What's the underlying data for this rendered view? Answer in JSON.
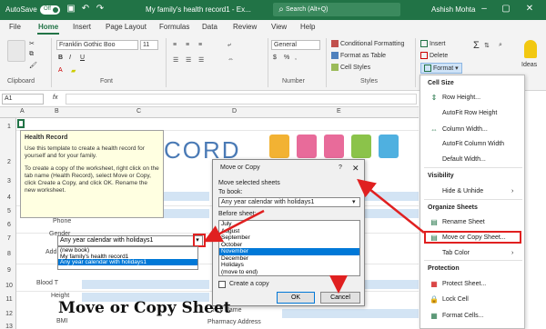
{
  "titlebar": {
    "autosave": "AutoSave",
    "toggle": "Off",
    "doc_title": "My family's health record1 - Ex...",
    "search_placeholder": "Search (Alt+Q)",
    "user": "Ashish Mohta"
  },
  "tabs": [
    "File",
    "Home",
    "Insert",
    "Page Layout",
    "Formulas",
    "Data",
    "Review",
    "View",
    "Help"
  ],
  "ribbon": {
    "clipboard_label": "Clipboard",
    "font_name": "Franklin Gothic Boo",
    "font_size": "11",
    "font_label": "Font",
    "number_format": "General",
    "number_label": "Number",
    "conditional_formatting": "Conditional Formatting",
    "format_as_table": "Format as Table",
    "cell_styles": "Cell Styles",
    "styles_label": "Styles",
    "insert": "Insert",
    "delete": "Delete",
    "format": "Format",
    "ideas": "Ideas"
  },
  "formula_bar": {
    "name_box": "A1",
    "fx": "fx"
  },
  "columns": [
    "A",
    "B",
    "C",
    "D",
    "E"
  ],
  "rows": [
    "1",
    "2",
    "3",
    "4",
    "5",
    "6",
    "7",
    "8",
    "9",
    "10",
    "11",
    "12",
    "13"
  ],
  "sheet": {
    "title_fragment": "CORD",
    "labels": [
      "Phone",
      "Gender",
      "Add",
      "Blood T",
      "Height",
      "BMI"
    ],
    "d_labels": [
      "ncy Name",
      "Pharmacy Address"
    ]
  },
  "tooltip": {
    "title": "Health Record",
    "body1": "Use this template to create a health record for yourself and for your family.",
    "body2": "To create a copy of the worksheet, right click on the tab name (Health Record), select Move or Copy, click Create a Copy, and click OK. Rename the new worksheet."
  },
  "combo": {
    "value": "Any year calendar with holidays1",
    "options": [
      "(new book)",
      "My family's health record1",
      "Any year calendar with holidays1"
    ],
    "selected_index": 2
  },
  "dialog": {
    "title": "Move or Copy",
    "help": "?",
    "close": "✕",
    "move_selected": "Move selected sheets",
    "to_book": "To book:",
    "book_value": "Any year calendar with holidays1",
    "before_sheet": "Before sheet:",
    "sheets": [
      "July",
      "August",
      "September",
      "October",
      "November",
      "December",
      "Holidays",
      "(move to end)"
    ],
    "selected_index": 4,
    "create_copy": "Create a copy",
    "ok": "OK",
    "cancel": "Cancel"
  },
  "format_menu": {
    "cell_size": "Cell Size",
    "row_height": "Row Height...",
    "autofit_row": "AutoFit Row Height",
    "column_width": "Column Width...",
    "autofit_column": "AutoFit Column Width",
    "default_width": "Default Width...",
    "visibility": "Visibility",
    "hide_unhide": "Hide & Unhide",
    "organize": "Organize Sheets",
    "rename": "Rename Sheet",
    "move_copy": "Move or Copy Sheet...",
    "tab_color": "Tab Color",
    "protection": "Protection",
    "protect": "Protect Sheet...",
    "lock": "Lock Cell",
    "format_cells": "Format Cells..."
  },
  "caption": "Move or Copy Sheet",
  "colors": {
    "excel_green": "#217346",
    "highlight": "#e02020",
    "selection": "#0078d7",
    "band": "#d3e4f4"
  }
}
